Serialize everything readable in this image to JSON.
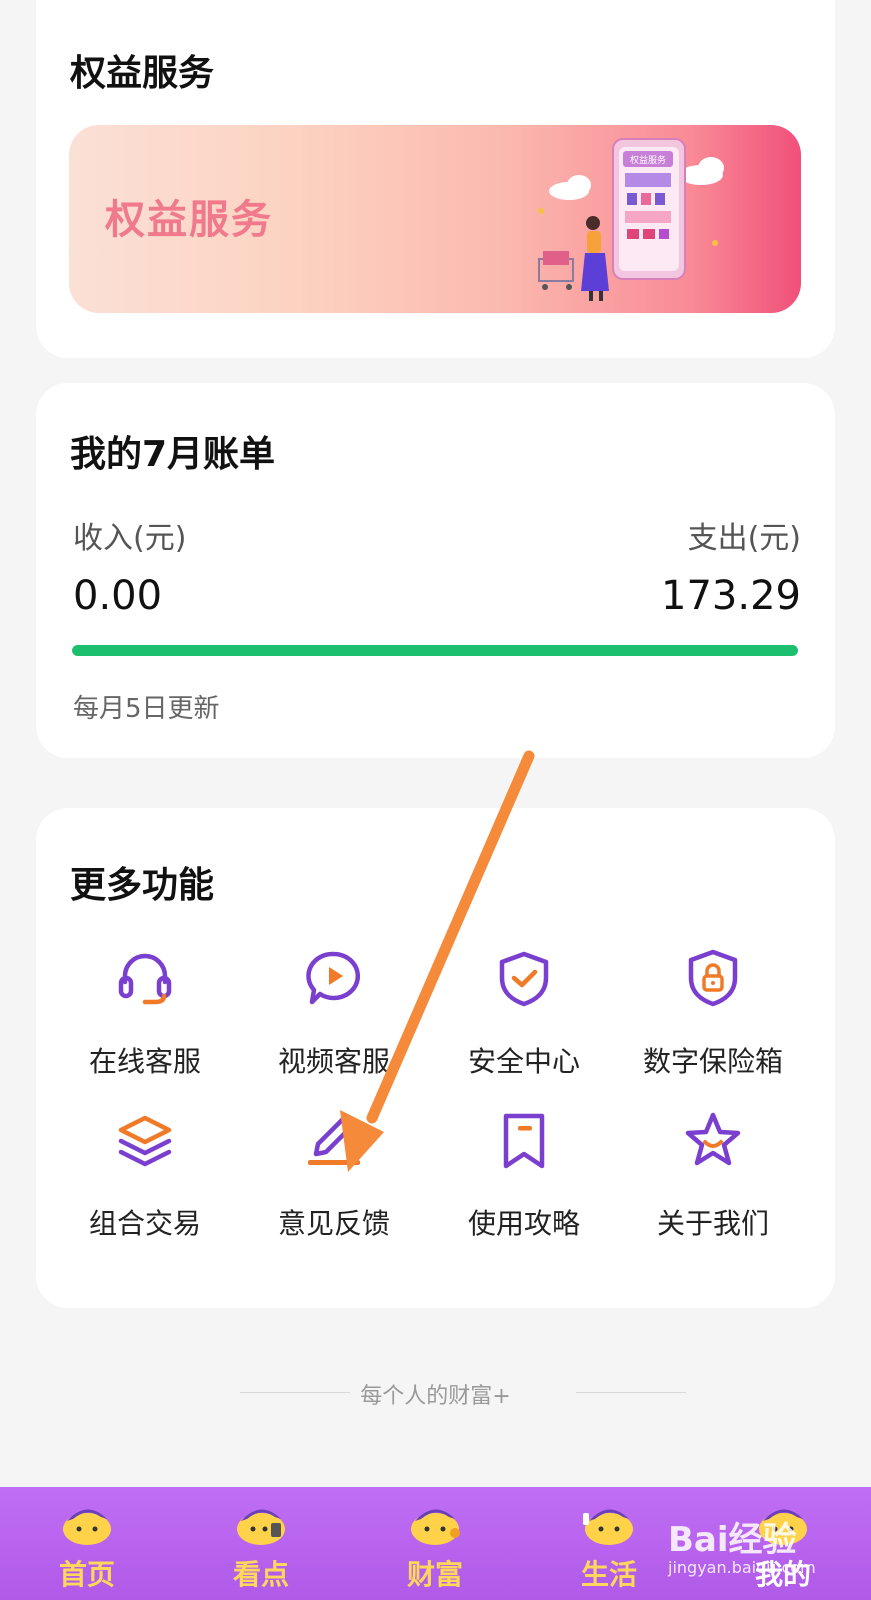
{
  "benefits": {
    "title": "权益服务",
    "banner_text": "权益服务",
    "banner_sign": "权益服务"
  },
  "bill": {
    "title": "我的7月账单",
    "income_label": "收入(元)",
    "expense_label": "支出(元)",
    "income_value": "0.00",
    "expense_value": "173.29",
    "progress_percent": 100,
    "progress_color": "#1cbf6e",
    "note": "每月5日更新"
  },
  "more": {
    "title": "更多功能",
    "items": [
      {
        "label": "在线客服",
        "icon": "headset-icon"
      },
      {
        "label": "视频客服",
        "icon": "video-chat-icon"
      },
      {
        "label": "安全中心",
        "icon": "shield-check-icon"
      },
      {
        "label": "数字保险箱",
        "icon": "lock-shield-icon"
      },
      {
        "label": "组合交易",
        "icon": "layers-icon"
      },
      {
        "label": "意见反馈",
        "icon": "pen-icon"
      },
      {
        "label": "使用攻略",
        "icon": "bookmark-icon"
      },
      {
        "label": "关于我们",
        "icon": "star-icon"
      }
    ]
  },
  "slogan": "每个人的财富+",
  "tabbar": {
    "items": [
      {
        "label": "首页"
      },
      {
        "label": "看点"
      },
      {
        "label": "财富"
      },
      {
        "label": "生活"
      },
      {
        "label": "我的"
      }
    ]
  },
  "watermark": {
    "text": "Bai经验",
    "sub": "jingyan.baidu.com"
  },
  "colors": {
    "accent_purple": "#7b3fd0",
    "accent_orange": "#f07a28",
    "tabbar": "#b862ef",
    "tab_label": "#ffd75a",
    "annotation_arrow": "#f58a3a"
  }
}
